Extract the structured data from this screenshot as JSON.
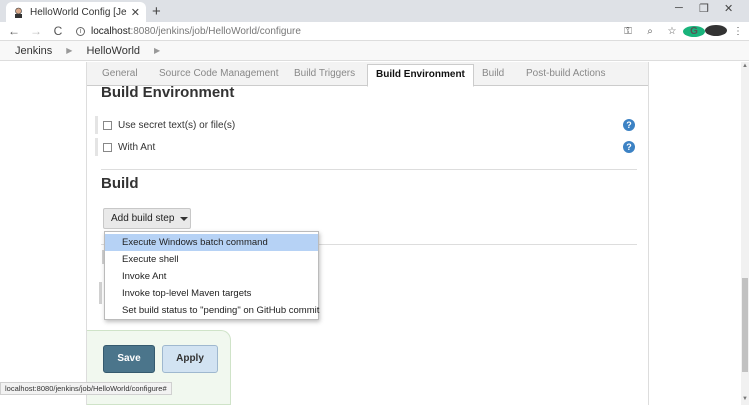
{
  "browser": {
    "tab_title": "HelloWorld Config [Jenkins]",
    "url_host": "localhost",
    "url_path": ":8080/jenkins/job/HelloWorld/configure",
    "status_url": "localhost:8080/jenkins/job/HelloWorld/configure#"
  },
  "breadcrumb": {
    "items": [
      "Jenkins",
      "HelloWorld"
    ]
  },
  "config_tabs": [
    "General",
    "Source Code Management",
    "Build Triggers",
    "Build Environment",
    "Build",
    "Post-build Actions"
  ],
  "build_environment": {
    "title": "Build Environment",
    "options": [
      {
        "label": "Use secret text(s) or file(s)",
        "checked": false
      },
      {
        "label": "With Ant",
        "checked": false
      }
    ]
  },
  "build": {
    "title": "Build",
    "add_step_label": "Add build step",
    "menu_items": [
      "Execute Windows batch command",
      "Execute shell",
      "Invoke Ant",
      "Invoke top-level Maven targets",
      "Set build status to \"pending\" on GitHub commit"
    ]
  },
  "buttons": {
    "save": "Save",
    "apply": "Apply"
  },
  "icons": {
    "help": "?"
  }
}
